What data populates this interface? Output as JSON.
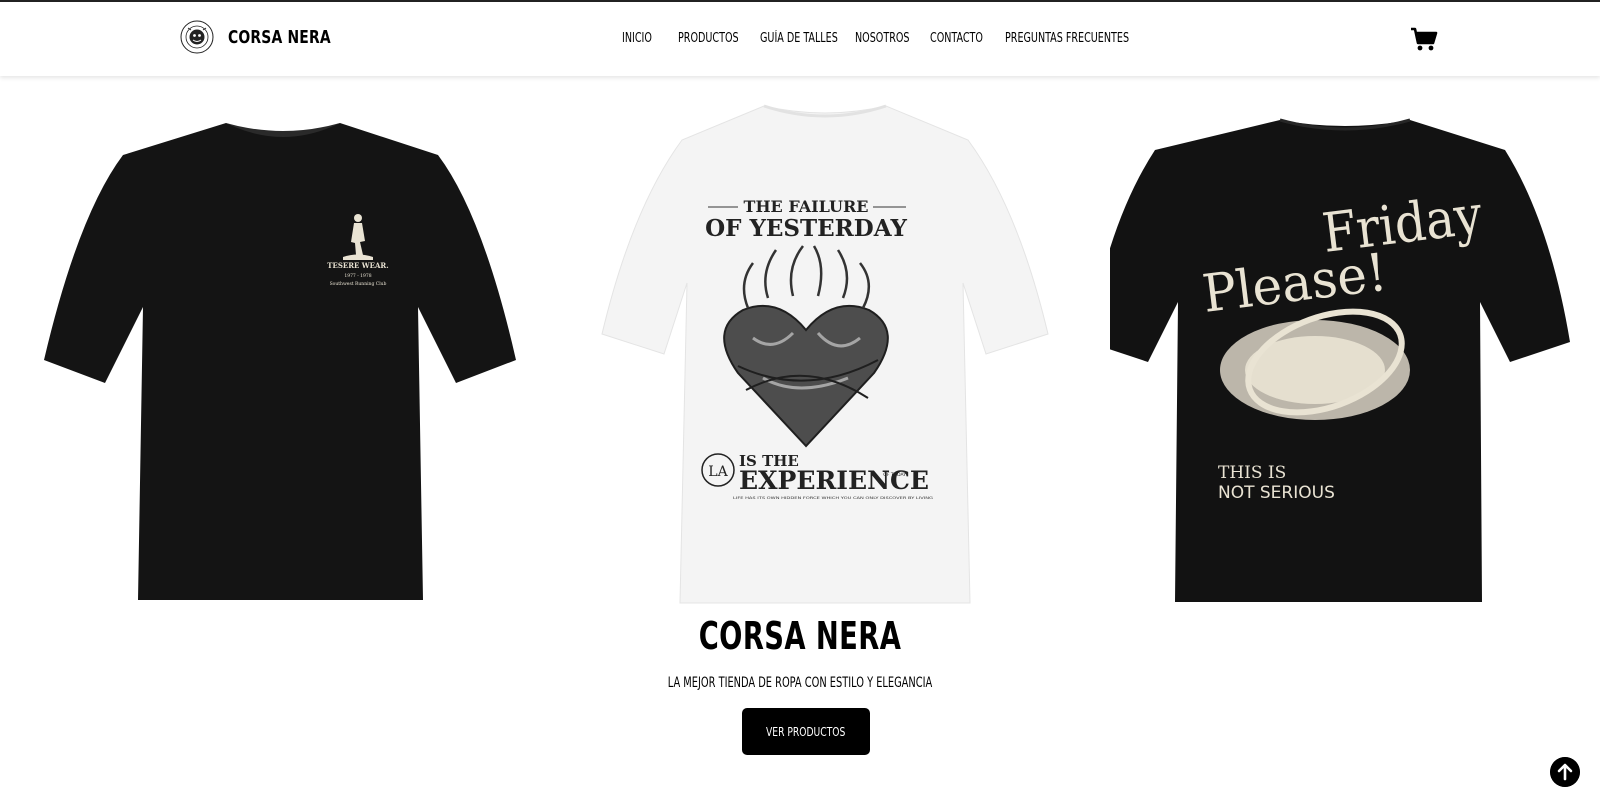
{
  "brand": {
    "name": "CORSA NERA",
    "logo_icon": "brand-seal-icon"
  },
  "nav": {
    "items": [
      {
        "label": "INICIO"
      },
      {
        "label": "PRODUCTOS"
      },
      {
        "label": "GUÍA DE TALLES"
      },
      {
        "label": "NOSOTROS"
      },
      {
        "label": "CONTACTO"
      },
      {
        "label": "PREGUNTAS FRECUENTES"
      }
    ]
  },
  "cart": {
    "icon": "shopping-cart-icon"
  },
  "shirts": {
    "left": {
      "color": "#141414",
      "print_title": "TESERE WEAR.",
      "print_years": "1977 - 1978",
      "print_club": "Southwest Running Club"
    },
    "center": {
      "color": "#f4f4f4",
      "line1": "THE FAILURE",
      "line2": "OF YESTERDAY",
      "monogram": "LA",
      "line3": "IS THE",
      "line4": "EXPERIENCE",
      "tag": "OF TODAY",
      "small_text": "LIFE HAS ITS OWN HIDDEN FORCE WHICH YOU CAN ONLY DISCOVER BY LIVING"
    },
    "right": {
      "color": "#121212",
      "line1": "Friday",
      "line2": "Please!",
      "line3": "THIS IS",
      "line4": "NOT SERIOUS"
    }
  },
  "hero": {
    "title": "CORSA NERA",
    "subtitle": "LA MEJOR TIENDA DE ROPA CON ESTILO Y ELEGANCIA",
    "cta_label": "VER PRODUCTOS"
  },
  "scroll_top": {
    "icon": "arrow-up-icon"
  },
  "colors": {
    "accent": "#000000",
    "background": "#ffffff",
    "print_cream": "#e9e3d3"
  }
}
